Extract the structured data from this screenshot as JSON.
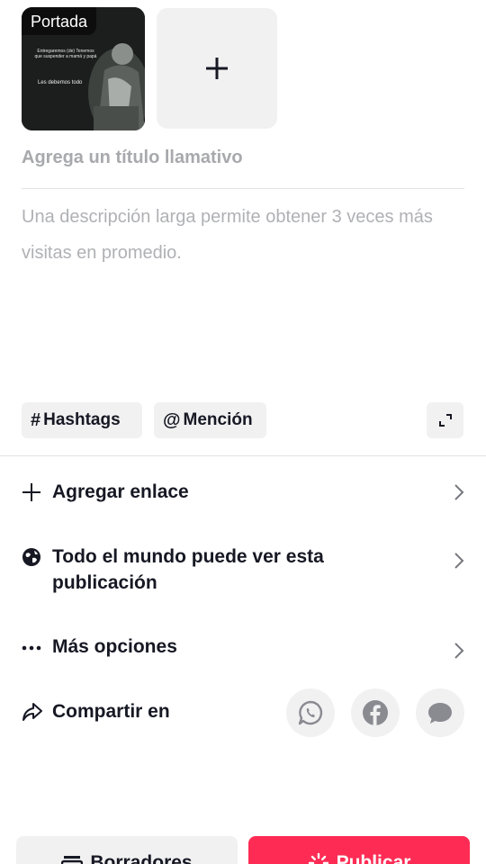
{
  "cover": {
    "badge": "Portada",
    "image_text_top": "Entregaremos (de) Tenemos que suspender a mamá y papá",
    "image_text_bottom": "Les debemos todo"
  },
  "add_media": {
    "icon": "plus-icon"
  },
  "title": {
    "placeholder": "Agrega un título llamativo"
  },
  "description": {
    "placeholder": "Una descripción larga permite obtener 3 veces más visitas en promedio."
  },
  "chips": {
    "hashtag": {
      "symbol": "#",
      "label": "Hashtags"
    },
    "mention": {
      "symbol": "@",
      "label": "Mención"
    }
  },
  "options": {
    "add_link": {
      "label": "Agregar enlace",
      "icon": "plus-icon"
    },
    "privacy": {
      "label_line1": "Todo el mundo puede ver esta",
      "label_line2": "publicación",
      "icon": "globe-icon"
    },
    "more": {
      "label": "Más opciones",
      "icon": "ellipsis-icon"
    },
    "share": {
      "label": "Compartir en",
      "icon": "share-arrow-icon",
      "targets": [
        "whatsapp-icon",
        "facebook-icon",
        "message-icon"
      ]
    }
  },
  "actions": {
    "drafts_label": "Borradores",
    "publish_label": "Publicar"
  },
  "colors": {
    "accent": "#fe2c55",
    "chip_bg": "#f1f1f2",
    "placeholder": "#b0b1b5",
    "text": "#161823"
  }
}
